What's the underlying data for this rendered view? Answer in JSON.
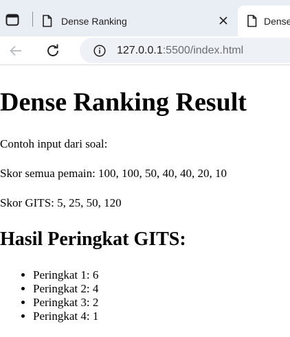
{
  "browser": {
    "tabs": [
      {
        "title": "Dense Ranking",
        "active": false
      },
      {
        "title": "Dense Ranking",
        "active": true
      }
    ],
    "url_host": "127.0.0.1",
    "url_rest": ":5500/index.html",
    "icons": [
      "tab-actions-icon",
      "document-icon",
      "close-icon",
      "back-arrow-icon",
      "reload-icon",
      "info-icon"
    ]
  },
  "page": {
    "title": "Dense Ranking Result",
    "intro": "Contoh input dari soal:",
    "all_scores": "Skor semua pemain: 100, 100, 50, 40, 40, 20, 10",
    "gits_scores": "Skor GITS: 5, 25, 50, 120",
    "result_heading": "Hasil Peringkat GITS:",
    "results": [
      "Peringkat 1: 6",
      "Peringkat 2: 4",
      "Peringkat 3: 2",
      "Peringkat 4: 1"
    ]
  }
}
